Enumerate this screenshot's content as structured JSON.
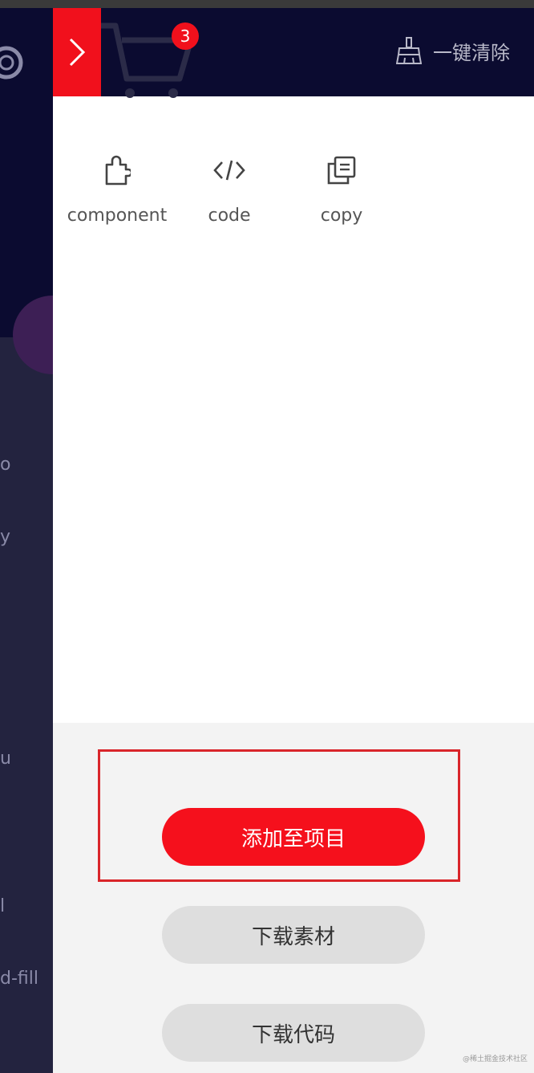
{
  "drawer": {
    "cart_count": "3",
    "clear_all_label": "一键清除",
    "items": [
      {
        "label": "component",
        "icon": "puzzle-icon"
      },
      {
        "label": "code",
        "icon": "code-icon"
      },
      {
        "label": "copy",
        "icon": "copy-icon"
      }
    ],
    "actions": {
      "add_to_project": "添加至项目",
      "download_assets": "下载素材",
      "download_code": "下载代码"
    },
    "watermark": "@稀土掘金技术社区"
  },
  "background_page": {
    "fragments": [
      "o",
      "y",
      "u",
      "l",
      "d-fill"
    ]
  },
  "colors": {
    "accent": "#f1101c",
    "header": "#0b0b30",
    "highlight_border": "#d9252a"
  }
}
